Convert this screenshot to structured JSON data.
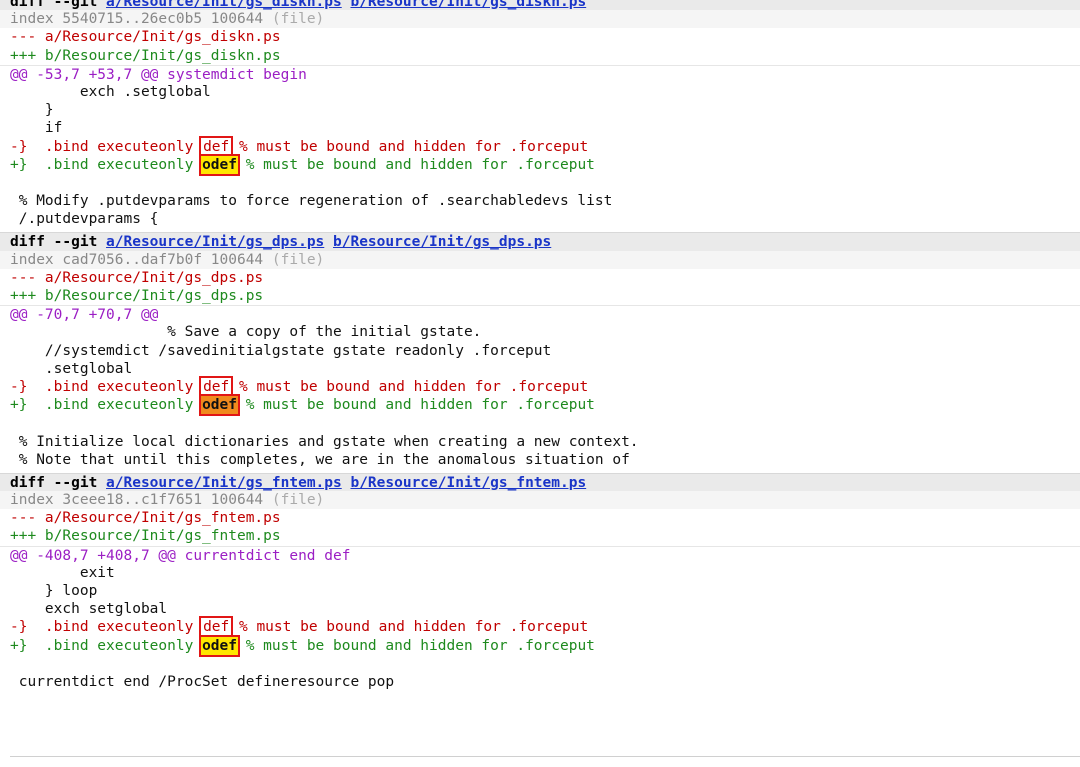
{
  "files": [
    {
      "header": {
        "prefix": "diff --git ",
        "a_path": "a/Resource/Init/gs_diskn.ps",
        "b_path": "b/Resource/Init/gs_diskn.ps"
      },
      "index_text": "index 5540715..26ec0b5 100644",
      "index_meta": "(file)",
      "minus_file": "--- a/Resource/Init/gs_diskn.ps",
      "plus_file": "+++ b/Resource/Init/gs_diskn.ps",
      "hunk": "@@ -53,7 +53,7 @@ systemdict begin",
      "context_before": [
        "        exch .setglobal",
        "    }",
        "    if"
      ],
      "removed": {
        "prefix": "-}  .bind executeonly ",
        "word": "def",
        "suffix": " % must be bound and hidden for .forceput"
      },
      "added": {
        "prefix": "+}  .bind executeonly ",
        "word": "odef",
        "suffix": " % must be bound and hidden for .forceput"
      },
      "context_after": [
        "",
        " % Modify .putdevparams to force regeneration of .searchabledevs list",
        " /.putdevparams {"
      ]
    },
    {
      "header": {
        "prefix": "diff --git ",
        "a_path": "a/Resource/Init/gs_dps.ps",
        "b_path": "b/Resource/Init/gs_dps.ps"
      },
      "index_text": "index cad7056..daf7b0f 100644",
      "index_meta": "(file)",
      "minus_file": "--- a/Resource/Init/gs_dps.ps",
      "plus_file": "+++ b/Resource/Init/gs_dps.ps",
      "hunk": "@@ -70,7 +70,7 @@",
      "context_before": [
        "                  % Save a copy of the initial gstate.",
        "    //systemdict /savedinitialgstate gstate readonly .forceput",
        "    .setglobal"
      ],
      "removed": {
        "prefix": "-}  .bind executeonly ",
        "word": "def",
        "suffix": " % must be bound and hidden for .forceput"
      },
      "added": {
        "prefix": "+}  .bind executeonly ",
        "word": "odef",
        "suffix": " % must be bound and hidden for .forceput"
      },
      "context_after": [
        "",
        " % Initialize local dictionaries and gstate when creating a new context.",
        " % Note that until this completes, we are in the anomalous situation of"
      ]
    },
    {
      "header": {
        "prefix": "diff --git ",
        "a_path": "a/Resource/Init/gs_fntem.ps",
        "b_path": "b/Resource/Init/gs_fntem.ps"
      },
      "index_text": "index 3ceee18..c1f7651 100644",
      "index_meta": "(file)",
      "minus_file": "--- a/Resource/Init/gs_fntem.ps",
      "plus_file": "+++ b/Resource/Init/gs_fntem.ps",
      "hunk": "@@ -408,7 +408,7 @@ currentdict end def",
      "context_before": [
        "        exit",
        "    } loop",
        "    exch setglobal"
      ],
      "removed": {
        "prefix": "-}  .bind executeonly ",
        "word": "def",
        "suffix": " % must be bound and hidden for .forceput"
      },
      "added": {
        "prefix": "+}  .bind executeonly ",
        "word": "odef",
        "suffix": " % must be bound and hidden for .forceput"
      },
      "context_after": [
        "",
        " currentdict end /ProcSet defineresource pop"
      ]
    }
  ],
  "colors": {
    "removed": "#c00000",
    "added": "#1e8a1e",
    "hunk": "#9b1ec4",
    "link": "#1a35c8",
    "highlight_yellow": "#ffe600",
    "highlight_orange": "#f08a1e",
    "annotation_box": "#e11616"
  }
}
